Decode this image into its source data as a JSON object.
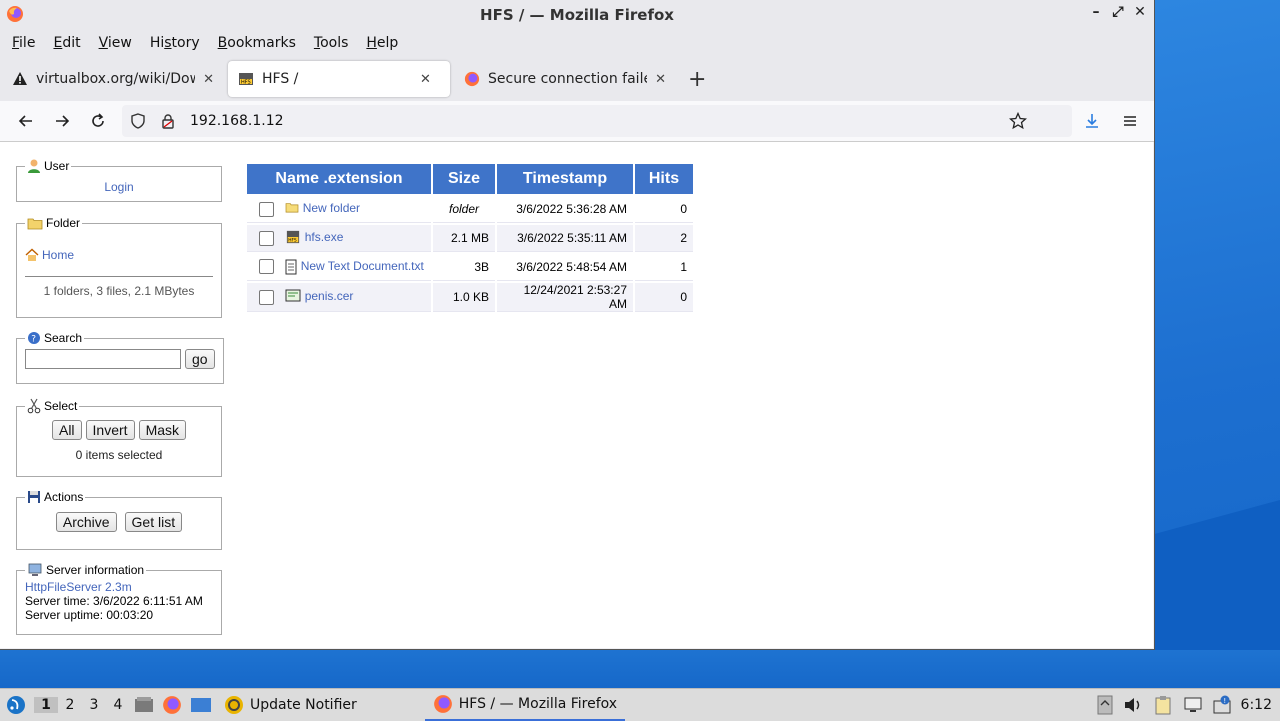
{
  "window": {
    "title": "HFS / — Mozilla Firefox",
    "controls": {
      "minimize": "–",
      "restore": "⤢",
      "close": "✕"
    }
  },
  "menubar": {
    "items": [
      {
        "label_first": "F",
        "label_rest": "ile"
      },
      {
        "label_first": "E",
        "label_rest": "dit"
      },
      {
        "label_first": "V",
        "label_rest": "iew"
      },
      {
        "label_pre": "Hi",
        "label_first": "s",
        "label_rest": "tory"
      },
      {
        "label_first": "B",
        "label_rest": "ookmarks"
      },
      {
        "label_first": "T",
        "label_rest": "ools"
      },
      {
        "label_first": "H",
        "label_rest": "elp"
      }
    ]
  },
  "tabs": [
    {
      "label": "virtualbox.org/wiki/Downl",
      "icon": "warning-icon"
    },
    {
      "label": "HFS /",
      "icon": "hfs-icon",
      "active": true
    },
    {
      "label": "Secure connection failed",
      "icon": "firefox-icon"
    }
  ],
  "tab_close": "✕",
  "newtab": "+",
  "navbar": {
    "url": "192.168.1.12"
  },
  "sidebar": {
    "user": {
      "legend": "User",
      "login": "Login"
    },
    "folder": {
      "legend": "Folder",
      "home": "Home",
      "summary": "1 folders, 3 files, 2.1 MBytes"
    },
    "search": {
      "legend": "Search",
      "go": "go",
      "placeholder": ""
    },
    "select": {
      "legend": "Select",
      "all": "All",
      "invert": "Invert",
      "mask": "Mask",
      "status": "0 items selected"
    },
    "actions": {
      "legend": "Actions",
      "archive": "Archive",
      "getlist": "Get list"
    },
    "server": {
      "legend": "Server information",
      "link": "HttpFileServer 2.3m",
      "time": "Server time: 3/6/2022 6:11:51 AM",
      "uptime": "Server uptime: 00:03:20"
    }
  },
  "filetable": {
    "headers": [
      "Name .extension",
      "Size",
      "Timestamp",
      "Hits"
    ],
    "rows": [
      {
        "name": "New folder",
        "icon": "folder-icon",
        "size": "folder",
        "timestamp": "3/6/2022 5:36:28 AM",
        "hits": "0"
      },
      {
        "name": "hfs.exe",
        "icon": "exe-icon",
        "size": "2.1 MB",
        "timestamp": "3/6/2022 5:35:11 AM",
        "hits": "2"
      },
      {
        "name": "New Text Document.txt",
        "icon": "text-file-icon",
        "size": "3B",
        "timestamp": "3/6/2022 5:48:54 AM",
        "hits": "1"
      },
      {
        "name": "penis.cer",
        "icon": "certificate-icon",
        "size": "1.0 KB",
        "timestamp": "12/24/2021 2:53:27 AM",
        "hits": "0"
      }
    ]
  },
  "taskbar": {
    "workspaces": [
      "1",
      "2",
      "3",
      "4"
    ],
    "tasks": [
      {
        "label": "Update Notifier"
      },
      {
        "label": "HFS / — Mozilla Firefox"
      }
    ],
    "clock": "6:12"
  }
}
